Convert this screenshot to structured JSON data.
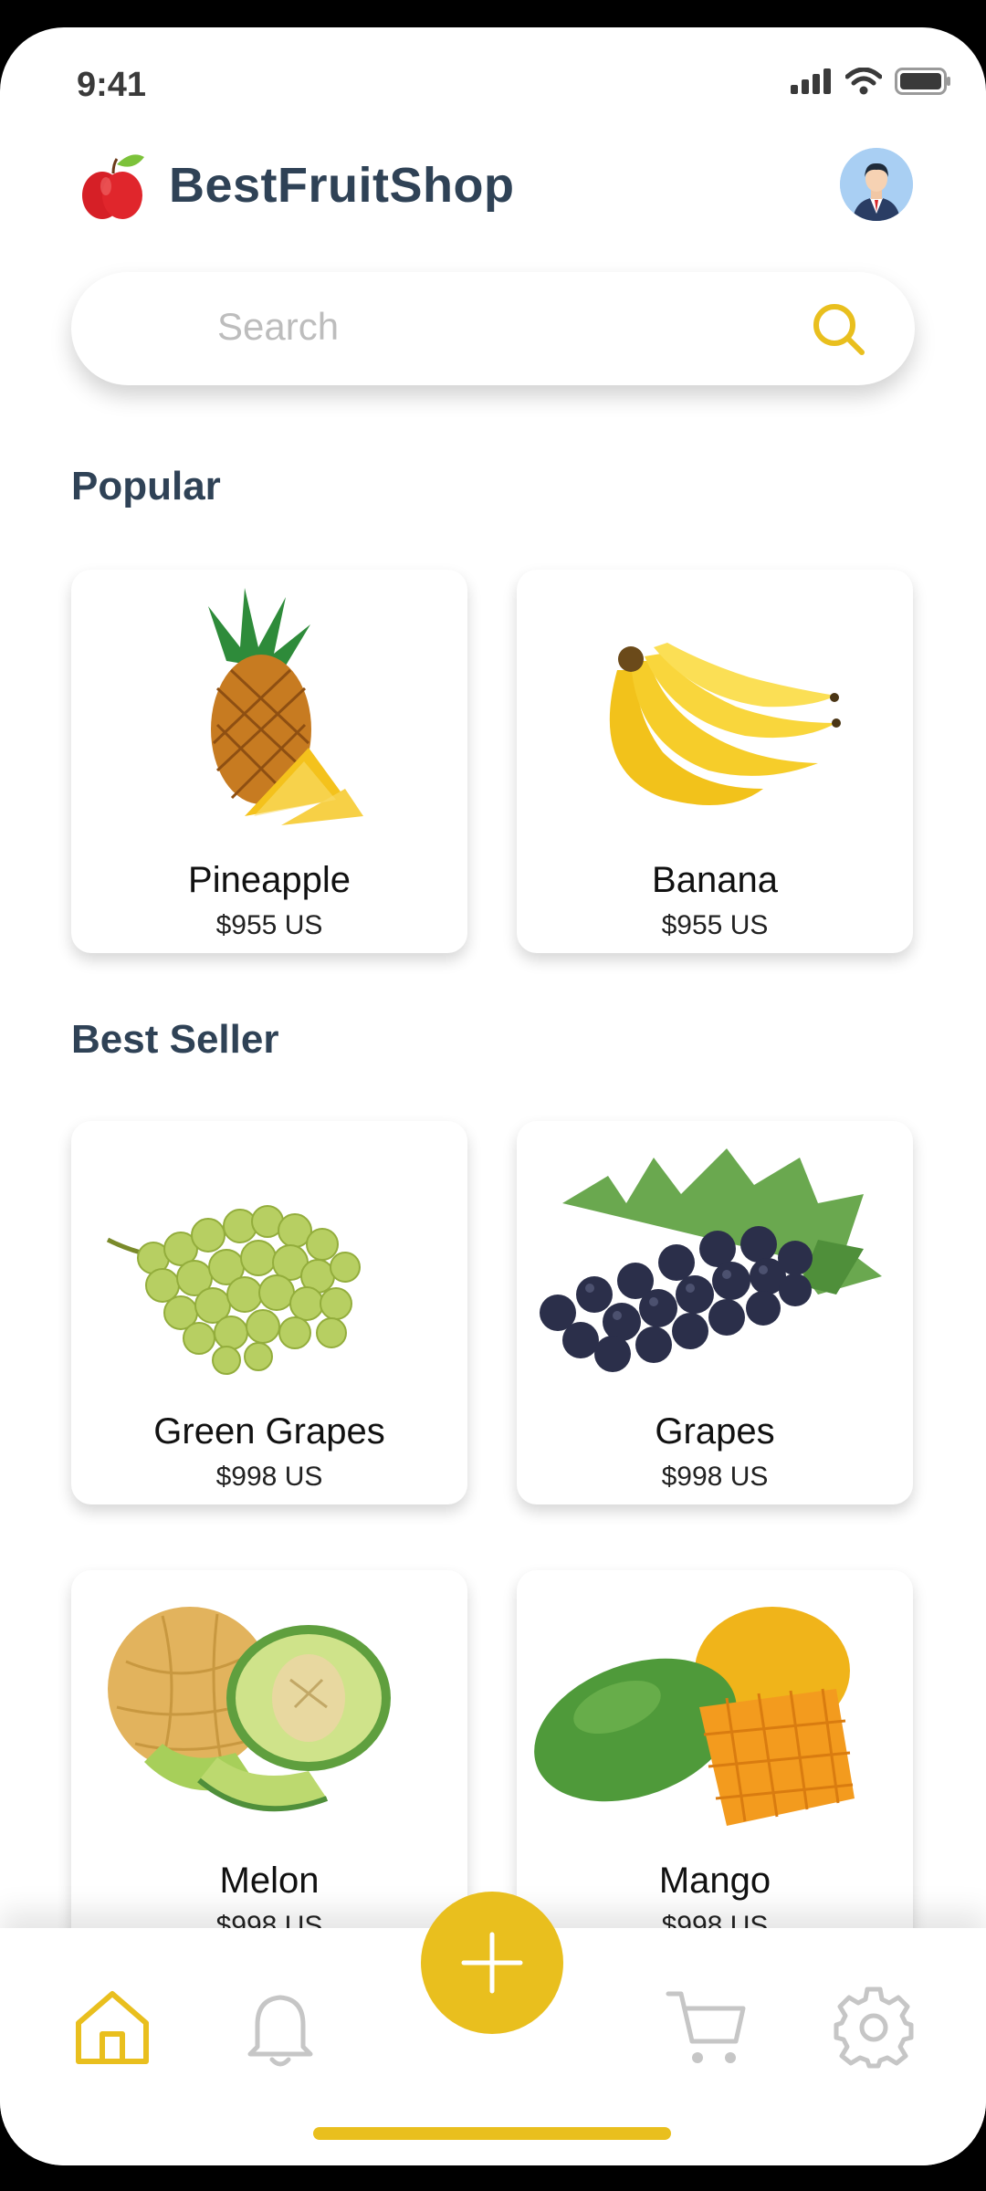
{
  "status_bar": {
    "time": "9:41"
  },
  "header": {
    "brand": "BestFruitShop"
  },
  "search": {
    "placeholder": "Search"
  },
  "sections": {
    "popular": {
      "title": "Popular",
      "items": [
        {
          "name": "Pineapple",
          "price": "$955 US"
        },
        {
          "name": "Banana",
          "price": "$955 US"
        }
      ]
    },
    "best_seller": {
      "title": "Best Seller",
      "items": [
        {
          "name": "Green Grapes",
          "price": "$998 US"
        },
        {
          "name": "Grapes",
          "price": "$998 US"
        },
        {
          "name": "Melon",
          "price": "$998 US"
        },
        {
          "name": "Mango",
          "price": "$998 US"
        }
      ]
    }
  },
  "nav": {
    "items": [
      {
        "icon": "home-icon",
        "active": true
      },
      {
        "icon": "bell-icon",
        "active": false
      },
      {
        "icon": "add-icon",
        "active": false
      },
      {
        "icon": "cart-icon",
        "active": false
      },
      {
        "icon": "gear-icon",
        "active": false
      }
    ]
  },
  "colors": {
    "accent": "#e9bf1e",
    "text_dark": "#2f4256",
    "inactive": "#c6c6c6"
  }
}
